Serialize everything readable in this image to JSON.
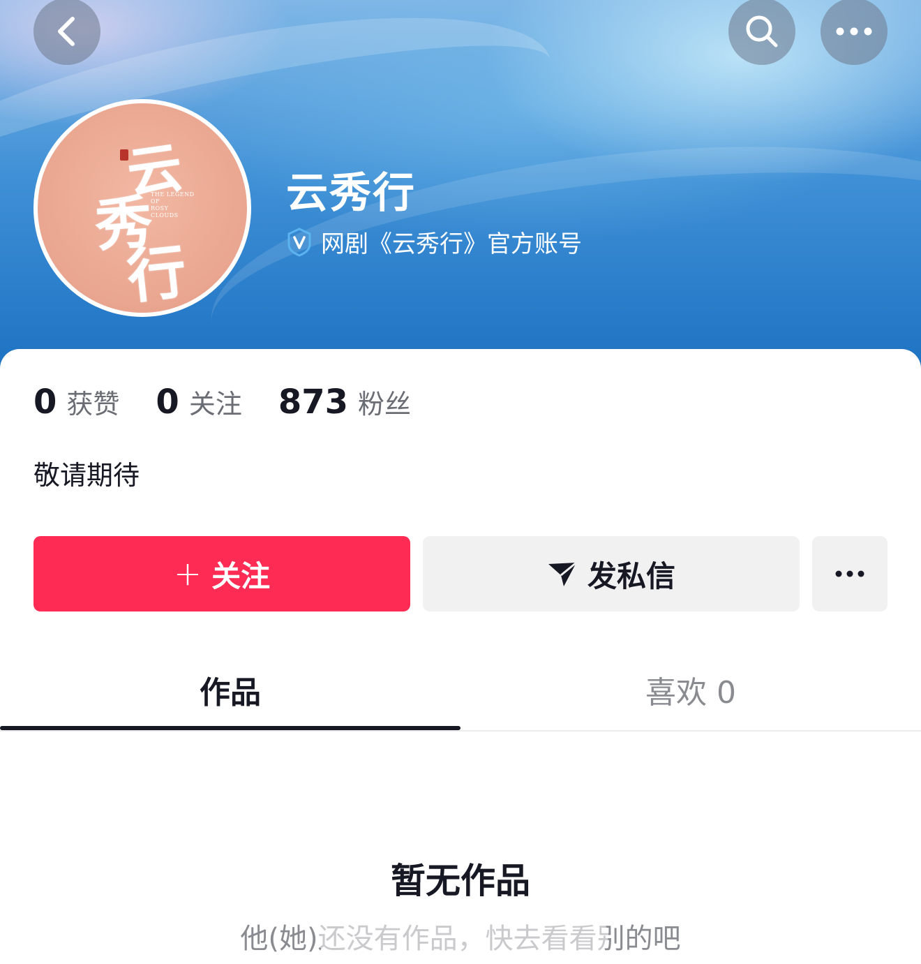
{
  "header": {
    "back_icon": "chevron-left-icon",
    "search_icon": "search-icon",
    "more_icon": "ellipsis-icon"
  },
  "profile": {
    "name": "云秀行",
    "verification": "网剧《云秀行》官方账号",
    "avatar_calligraphy": [
      "云",
      "秀",
      "行"
    ],
    "avatar_english": [
      "THE LEGEND",
      "OF",
      "ROSY",
      "CLOUDS"
    ]
  },
  "stats": [
    {
      "value": "0",
      "label": "获赞"
    },
    {
      "value": "0",
      "label": "关注"
    },
    {
      "value": "873",
      "label": "粉丝"
    }
  ],
  "bio": "敬请期待",
  "actions": {
    "follow_plus": "+",
    "follow_label": "关注",
    "message_label": "发私信"
  },
  "tabs": [
    {
      "label": "作品"
    },
    {
      "label": "喜欢 0"
    }
  ],
  "empty_state": {
    "title": "暂无作品",
    "subtitle": "他(她)还没有作品，快去看看别的吧"
  },
  "colors": {
    "accent": "#fe2c55",
    "text_primary": "#161823",
    "text_secondary": "#8a8b91",
    "button_gray": "#f1f1f2"
  }
}
